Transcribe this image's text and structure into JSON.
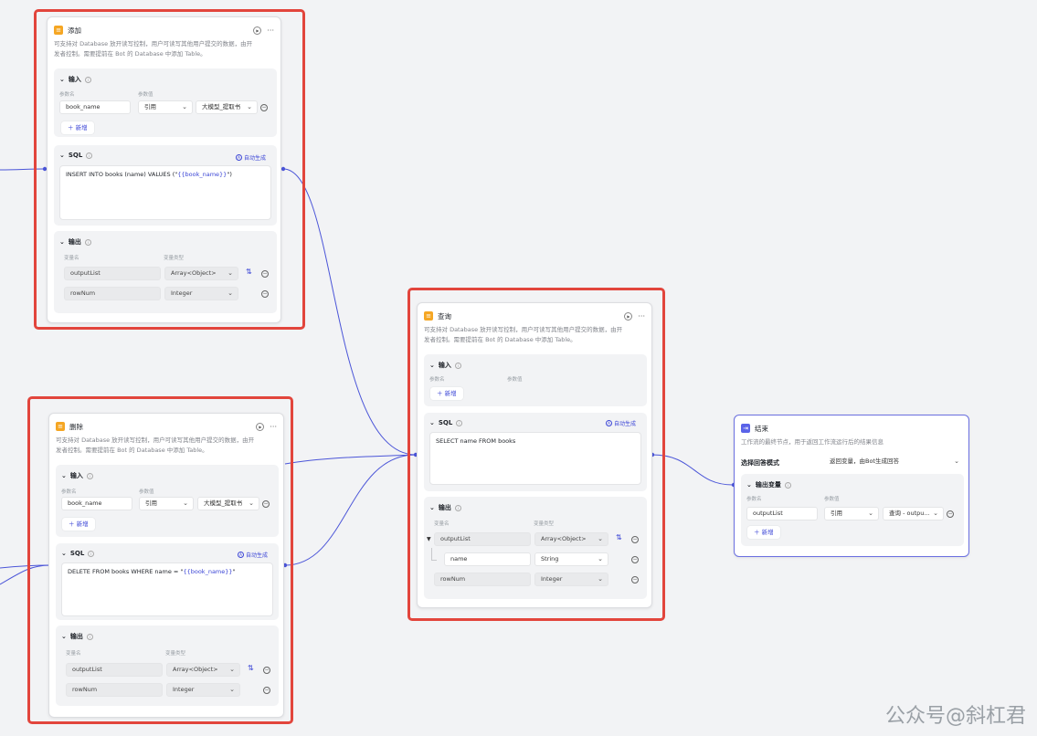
{
  "colors": {
    "accent": "#3c46d6",
    "highlight": "#e2453c",
    "node_icon_db": "#f5a623",
    "node_icon_end": "#5a63e8"
  },
  "common": {
    "desc_line1": "可支持对 Database 放开读写控制，用户可读写其他用户提交的数据，由开",
    "desc_line2": "发者控制。需要提前在 Bot 的 Database 中添加 Table。",
    "input": "输入",
    "output": "输出",
    "sql": "SQL",
    "auto_gen": "自动生成",
    "param_name": "参数名",
    "param_value": "参数值",
    "var_name": "变量名",
    "var_type": "变量类型",
    "add": "新增",
    "ref": "引用",
    "llm_extract": "大模型_提取书",
    "outputList": "outputList",
    "rowNum": "rowNum",
    "arr_obj": "Array<Object>",
    "integer": "Integer",
    "string": "String",
    "name": "name"
  },
  "nodes": {
    "add": {
      "title": "添加",
      "param": "book_name",
      "sql_prefix": "INSERT INTO books (name) VALUES (\"",
      "sql_var": "{{book_name}}",
      "sql_suffix": "\")"
    },
    "delete": {
      "title": "删除",
      "param": "book_name",
      "sql_prefix": "DELETE FROM books WHERE name = \"",
      "sql_var": "{{book_name}}",
      "sql_suffix": "\""
    },
    "query": {
      "title": "查询",
      "sql": "SELECT name FROM books"
    },
    "end": {
      "title": "结束",
      "desc": "工作流的最终节点，用于返回工作流运行后的结果信息",
      "mode_label": "选择回答模式",
      "mode_value": "返回变量，由Bot生成回答",
      "out_var": "输出变量",
      "param": "outputList",
      "ref": "引用",
      "ref_value": "查询 - outpu..."
    }
  },
  "watermark": "公众号@斜杠君"
}
